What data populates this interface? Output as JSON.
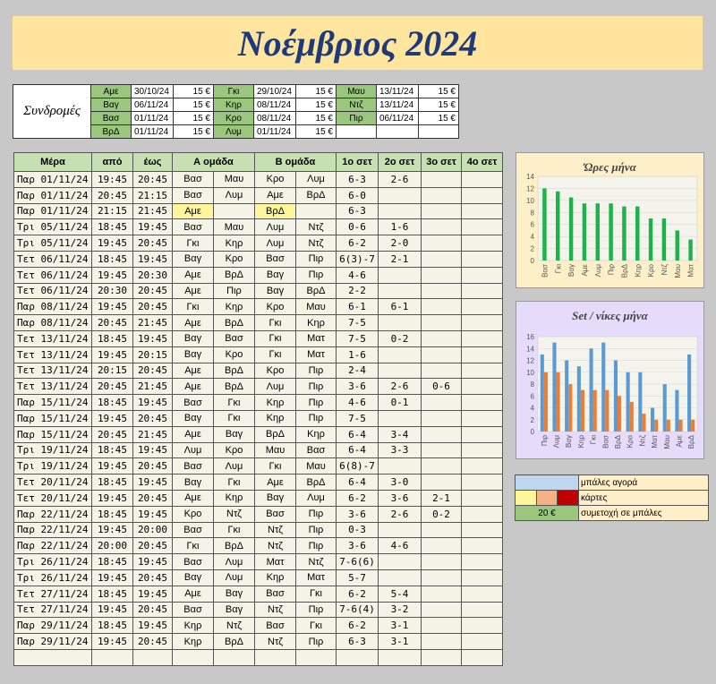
{
  "title": "Νοέμβριος 2024",
  "subscriptions": {
    "label": "Συνδρομές",
    "rows": [
      [
        [
          "Αμε",
          "30/10/24",
          "15 €"
        ],
        [
          "Γκι",
          "29/10/24",
          "15 €"
        ],
        [
          "Μαυ",
          "13/11/24",
          "15 €"
        ]
      ],
      [
        [
          "Βαγ",
          "06/11/24",
          "15 €"
        ],
        [
          "Κηρ",
          "08/11/24",
          "15 €"
        ],
        [
          "Ντζ",
          "13/11/24",
          "15 €"
        ]
      ],
      [
        [
          "Βασ",
          "01/11/24",
          "15 €"
        ],
        [
          "Κρο",
          "08/11/24",
          "15 €"
        ],
        [
          "Πιρ",
          "06/11/24",
          "15 €"
        ]
      ],
      [
        [
          "ΒρΔ",
          "01/11/24",
          "15 €"
        ],
        [
          "Λυμ",
          "01/11/24",
          "15 €"
        ],
        [
          "",
          "",
          ""
        ]
      ]
    ]
  },
  "games": {
    "headers": [
      "Μέρα",
      "από",
      "έως",
      "Α ομάδα",
      "",
      "Β ομάδα",
      "",
      "1ο σετ",
      "2ο σετ",
      "3ο σετ",
      "4ο σετ"
    ],
    "rows": [
      [
        "Παρ 01/11/24",
        "19:45",
        "20:45",
        "Βασ",
        "Μαυ",
        "Κρο",
        "Λυμ",
        "6-3",
        "2-6",
        "",
        ""
      ],
      [
        "Παρ 01/11/24",
        "20:45",
        "21:15",
        "Βασ",
        "Λυμ",
        "Αμε",
        "ΒρΔ",
        "6-0",
        "",
        "",
        ""
      ],
      [
        "Παρ 01/11/24",
        "21:15",
        "21:45",
        "Αμε",
        "",
        "ΒρΔ",
        "",
        "6-3",
        "",
        "",
        ""
      ],
      [
        "Τρι 05/11/24",
        "18:45",
        "19:45",
        "Βασ",
        "Μαυ",
        "Λυμ",
        "Ντζ",
        "0-6",
        "1-6",
        "",
        ""
      ],
      [
        "Τρι 05/11/24",
        "19:45",
        "20:45",
        "Γκι",
        "Κηρ",
        "Λυμ",
        "Ντζ",
        "6-2",
        "2-0",
        "",
        ""
      ],
      [
        "Τετ 06/11/24",
        "18:45",
        "19:45",
        "Βαγ",
        "Κρο",
        "Βασ",
        "Πιρ",
        "6(3)-7",
        "2-1",
        "",
        ""
      ],
      [
        "Τετ 06/11/24",
        "19:45",
        "20:30",
        "Αμε",
        "ΒρΔ",
        "Βαγ",
        "Πιρ",
        "4-6",
        "",
        "",
        ""
      ],
      [
        "Τετ 06/11/24",
        "20:30",
        "20:45",
        "Αμε",
        "Πιρ",
        "Βαγ",
        "ΒρΔ",
        "2-2",
        "",
        "",
        ""
      ],
      [
        "Παρ 08/11/24",
        "19:45",
        "20:45",
        "Γκι",
        "Κηρ",
        "Κρο",
        "Μαυ",
        "6-1",
        "6-1",
        "",
        ""
      ],
      [
        "Παρ 08/11/24",
        "20:45",
        "21:45",
        "Αμε",
        "ΒρΔ",
        "Γκι",
        "Κηρ",
        "7-5",
        "",
        "",
        ""
      ],
      [
        "Τετ 13/11/24",
        "18:45",
        "19:45",
        "Βαγ",
        "Βασ",
        "Γκι",
        "Ματ",
        "7-5",
        "0-2",
        "",
        ""
      ],
      [
        "Τετ 13/11/24",
        "19:45",
        "20:15",
        "Βαγ",
        "Κρο",
        "Γκι",
        "Ματ",
        "1-6",
        "",
        "",
        ""
      ],
      [
        "Τετ 13/11/24",
        "20:15",
        "20:45",
        "Αμε",
        "ΒρΔ",
        "Κρο",
        "Πιρ",
        "2-4",
        "",
        "",
        ""
      ],
      [
        "Τετ 13/11/24",
        "20:45",
        "21:45",
        "Αμε",
        "ΒρΔ",
        "Λυμ",
        "Πιρ",
        "3-6",
        "2-6",
        "0-6",
        ""
      ],
      [
        "Παρ 15/11/24",
        "18:45",
        "19:45",
        "Βασ",
        "Γκι",
        "Κηρ",
        "Πιρ",
        "4-6",
        "0-1",
        "",
        ""
      ],
      [
        "Παρ 15/11/24",
        "19:45",
        "20:45",
        "Βαγ",
        "Γκι",
        "Κηρ",
        "Πιρ",
        "7-5",
        "",
        "",
        ""
      ],
      [
        "Παρ 15/11/24",
        "20:45",
        "21:45",
        "Αμε",
        "Βαγ",
        "ΒρΔ",
        "Κηρ",
        "6-4",
        "3-4",
        "",
        ""
      ],
      [
        "Τρι 19/11/24",
        "18:45",
        "19:45",
        "Λυμ",
        "Κρο",
        "Μαυ",
        "Βασ",
        "6-4",
        "3-3",
        "",
        ""
      ],
      [
        "Τρι 19/11/24",
        "19:45",
        "20:45",
        "Βασ",
        "Λυμ",
        "Γκι",
        "Μαυ",
        "6(8)-7",
        "",
        "",
        ""
      ],
      [
        "Τετ 20/11/24",
        "18:45",
        "19:45",
        "Βαγ",
        "Γκι",
        "Αμε",
        "ΒρΔ",
        "6-4",
        "3-0",
        "",
        ""
      ],
      [
        "Τετ 20/11/24",
        "19:45",
        "20:45",
        "Αμε",
        "Κηρ",
        "Βαγ",
        "Λυμ",
        "6-2",
        "3-6",
        "2-1",
        ""
      ],
      [
        "Παρ 22/11/24",
        "18:45",
        "19:45",
        "Κρο",
        "Ντζ",
        "Βασ",
        "Πιρ",
        "3-6",
        "2-6",
        "0-2",
        ""
      ],
      [
        "Παρ 22/11/24",
        "19:45",
        "20:00",
        "Βασ",
        "Γκι",
        "Ντζ",
        "Πιρ",
        "0-3",
        "",
        "",
        ""
      ],
      [
        "Παρ 22/11/24",
        "20:00",
        "20:45",
        "Γκι",
        "ΒρΔ",
        "Ντζ",
        "Πιρ",
        "3-6",
        "4-6",
        "",
        ""
      ],
      [
        "Τρι 26/11/24",
        "18:45",
        "19:45",
        "Βασ",
        "Λυμ",
        "Ματ",
        "Ντζ",
        "7-6(6)",
        "",
        "",
        ""
      ],
      [
        "Τρι 26/11/24",
        "19:45",
        "20:45",
        "Βαγ",
        "Λυμ",
        "Κηρ",
        "Ματ",
        "5-7",
        "",
        "",
        ""
      ],
      [
        "Τετ 27/11/24",
        "18:45",
        "19:45",
        "Αμε",
        "Βαγ",
        "Βασ",
        "Γκι",
        "6-2",
        "5-4",
        "",
        ""
      ],
      [
        "Τετ 27/11/24",
        "19:45",
        "20:45",
        "Βασ",
        "Βαγ",
        "Ντζ",
        "Πιρ",
        "7-6(4)",
        "3-2",
        "",
        ""
      ],
      [
        "Παρ 29/11/24",
        "18:45",
        "19:45",
        "Κηρ",
        "Ντζ",
        "Βασ",
        "Γκι",
        "6-2",
        "3-1",
        "",
        ""
      ],
      [
        "Παρ 29/11/24",
        "19:45",
        "20:45",
        "Κηρ",
        "ΒρΔ",
        "Ντζ",
        "Πιρ",
        "6-3",
        "3-1",
        "",
        ""
      ],
      [
        "",
        "",
        "",
        "",
        "",
        "",
        "",
        "",
        "",
        "",
        ""
      ]
    ]
  },
  "chart_data": [
    {
      "type": "bar",
      "title": "Ώρες μήνα",
      "categories": [
        "Βασ",
        "Γκι",
        "Βαγ",
        "Αμε",
        "Λυμ",
        "Πιρ",
        "ΒρΔ",
        "Κηρ",
        "Κρο",
        "Ντζ",
        "Μαυ",
        "Ματ"
      ],
      "values": [
        12,
        11.5,
        10.5,
        9.5,
        9.5,
        9.5,
        9,
        9,
        7,
        7,
        5,
        3.5
      ],
      "ylim": [
        0,
        14
      ],
      "yticks": [
        0,
        2,
        4,
        6,
        8,
        10,
        12,
        14
      ],
      "colors": [
        "#1db34a"
      ]
    },
    {
      "type": "bar",
      "title": "Set / νίκες μήνα",
      "categories": [
        "Πιρ",
        "Λυμ",
        "Βαγ",
        "Κηρ",
        "Γκι",
        "Βασ",
        "ΒρΔ",
        "Κρο",
        "Ντζ",
        "Ματ",
        "Μαυ",
        "Αμε",
        "ΒρΔ"
      ],
      "series": [
        {
          "values": [
            13,
            15,
            12,
            11,
            14,
            15,
            12,
            10,
            10,
            4,
            8,
            7,
            13
          ],
          "color": "#5b9bd5"
        },
        {
          "values": [
            10,
            10,
            8,
            7,
            7,
            7,
            6,
            5,
            3,
            2,
            2,
            2,
            2
          ],
          "color": "#ed7d31"
        }
      ],
      "ylim": [
        0,
        16
      ],
      "yticks": [
        0,
        2,
        4,
        6,
        8,
        10,
        12,
        14,
        16
      ]
    }
  ],
  "legend": [
    {
      "colors": [
        "#bdd7ee"
      ],
      "text": "μπάλες αγορά"
    },
    {
      "colors": [
        "#fff59a",
        "#f4b183",
        "#c00000"
      ],
      "text": "κάρτες"
    },
    {
      "value": "20 €",
      "color": "#9bc67e",
      "text": "συμετοχή σε μπάλες"
    }
  ]
}
